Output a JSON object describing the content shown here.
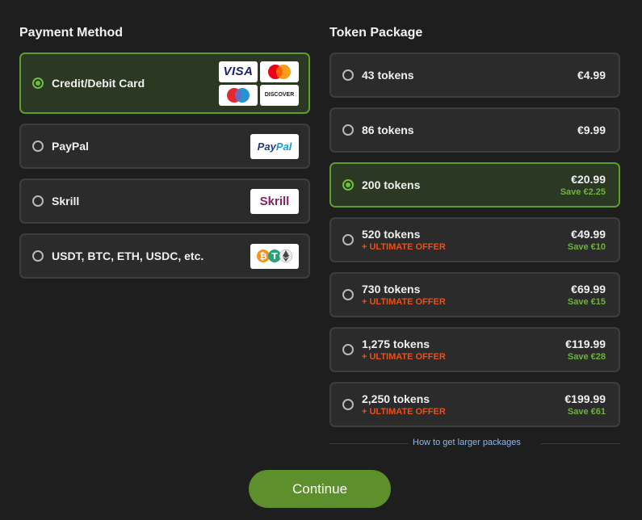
{
  "payment": {
    "title": "Payment Method",
    "methods": [
      {
        "label": "Credit/Debit Card",
        "selected": true,
        "logos": [
          "VISA",
          "Mastercard",
          "Maestro",
          "DISCOVER"
        ]
      },
      {
        "label": "PayPal",
        "selected": false,
        "logo_text_a": "Pay",
        "logo_text_b": "Pal"
      },
      {
        "label": "Skrill",
        "selected": false,
        "logo_text": "Skrill"
      },
      {
        "label": "USDT, BTC, ETH, USDC, etc.",
        "selected": false,
        "logo": "crypto-coins"
      }
    ]
  },
  "tokens": {
    "title": "Token Package",
    "packages": [
      {
        "amount": "43 tokens",
        "price": "€4.99",
        "save": "",
        "offer": "",
        "selected": false
      },
      {
        "amount": "86 tokens",
        "price": "€9.99",
        "save": "",
        "offer": "",
        "selected": false
      },
      {
        "amount": "200 tokens",
        "price": "€20.99",
        "save": "Save €2.25",
        "offer": "",
        "selected": true
      },
      {
        "amount": "520 tokens",
        "price": "€49.99",
        "save": "Save €10",
        "offer": "+ ULTIMATE OFFER",
        "selected": false
      },
      {
        "amount": "730 tokens",
        "price": "€69.99",
        "save": "Save €15",
        "offer": "+ ULTIMATE OFFER",
        "selected": false
      },
      {
        "amount": "1,275 tokens",
        "price": "€119.99",
        "save": "Save €28",
        "offer": "+ ULTIMATE OFFER",
        "selected": false
      },
      {
        "amount": "2,250 tokens",
        "price": "€199.99",
        "save": "Save €61",
        "offer": "+ ULTIMATE OFFER",
        "selected": false
      }
    ],
    "larger_link": "How to get larger packages"
  },
  "continue_label": "Continue",
  "colors": {
    "accent": "#5d8f2c",
    "selected_border": "#5d9e2c",
    "offer": "#e8511c",
    "save": "#6db33f",
    "link": "#8fb8e8"
  }
}
